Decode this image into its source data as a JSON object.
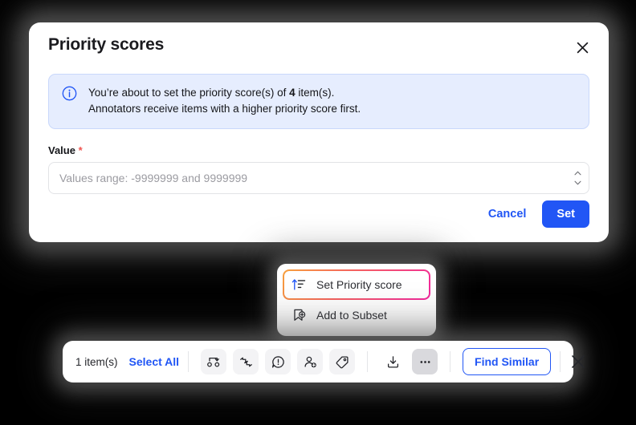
{
  "modal": {
    "title": "Priority scores",
    "close_icon": "close-icon",
    "banner": {
      "icon": "info-circle-icon",
      "line1_prefix": "You’re about to set the priority score(s) of ",
      "line1_bold": "4",
      "line1_suffix": " item(s).",
      "line2": "Annotators receive items with a higher priority score first.",
      "background_color": "#e6edfe",
      "icon_color": "#2156f5"
    },
    "field": {
      "label": "Value",
      "required_marker": "*",
      "required_color": "#f0534f",
      "value": "",
      "placeholder": "Values range: -9999999 and 9999999",
      "spinner_up_icon": "chevron-up-icon",
      "spinner_down_icon": "chevron-down-icon"
    },
    "actions": {
      "cancel_label": "Cancel",
      "set_label": "Set",
      "primary_color": "#2156f5"
    }
  },
  "context_menu": {
    "highlight_gradient_from": "#f7a13c",
    "highlight_gradient_to": "#f2269e",
    "items": [
      {
        "label": "Set Priority score",
        "icon": "sort-ascending-icon",
        "highlighted": true
      },
      {
        "label": "Add to Subset",
        "icon": "add-to-subset-icon",
        "highlighted": false
      }
    ]
  },
  "toolbar": {
    "count_label": "1 item(s)",
    "select_all_label": "Select All",
    "link_color": "#2156f5",
    "icons": [
      {
        "name": "merge-items-icon",
        "style": "chip"
      },
      {
        "name": "compare-items-icon",
        "style": "chip"
      },
      {
        "name": "report-issue-icon",
        "style": "chip"
      },
      {
        "name": "assign-user-icon",
        "style": "chip"
      },
      {
        "name": "tag-icon",
        "style": "chip"
      },
      {
        "name": "download-icon",
        "style": "plain"
      },
      {
        "name": "more-options-icon",
        "style": "chip-active"
      }
    ],
    "find_similar_label": "Find Similar",
    "close_icon": "close-icon"
  }
}
